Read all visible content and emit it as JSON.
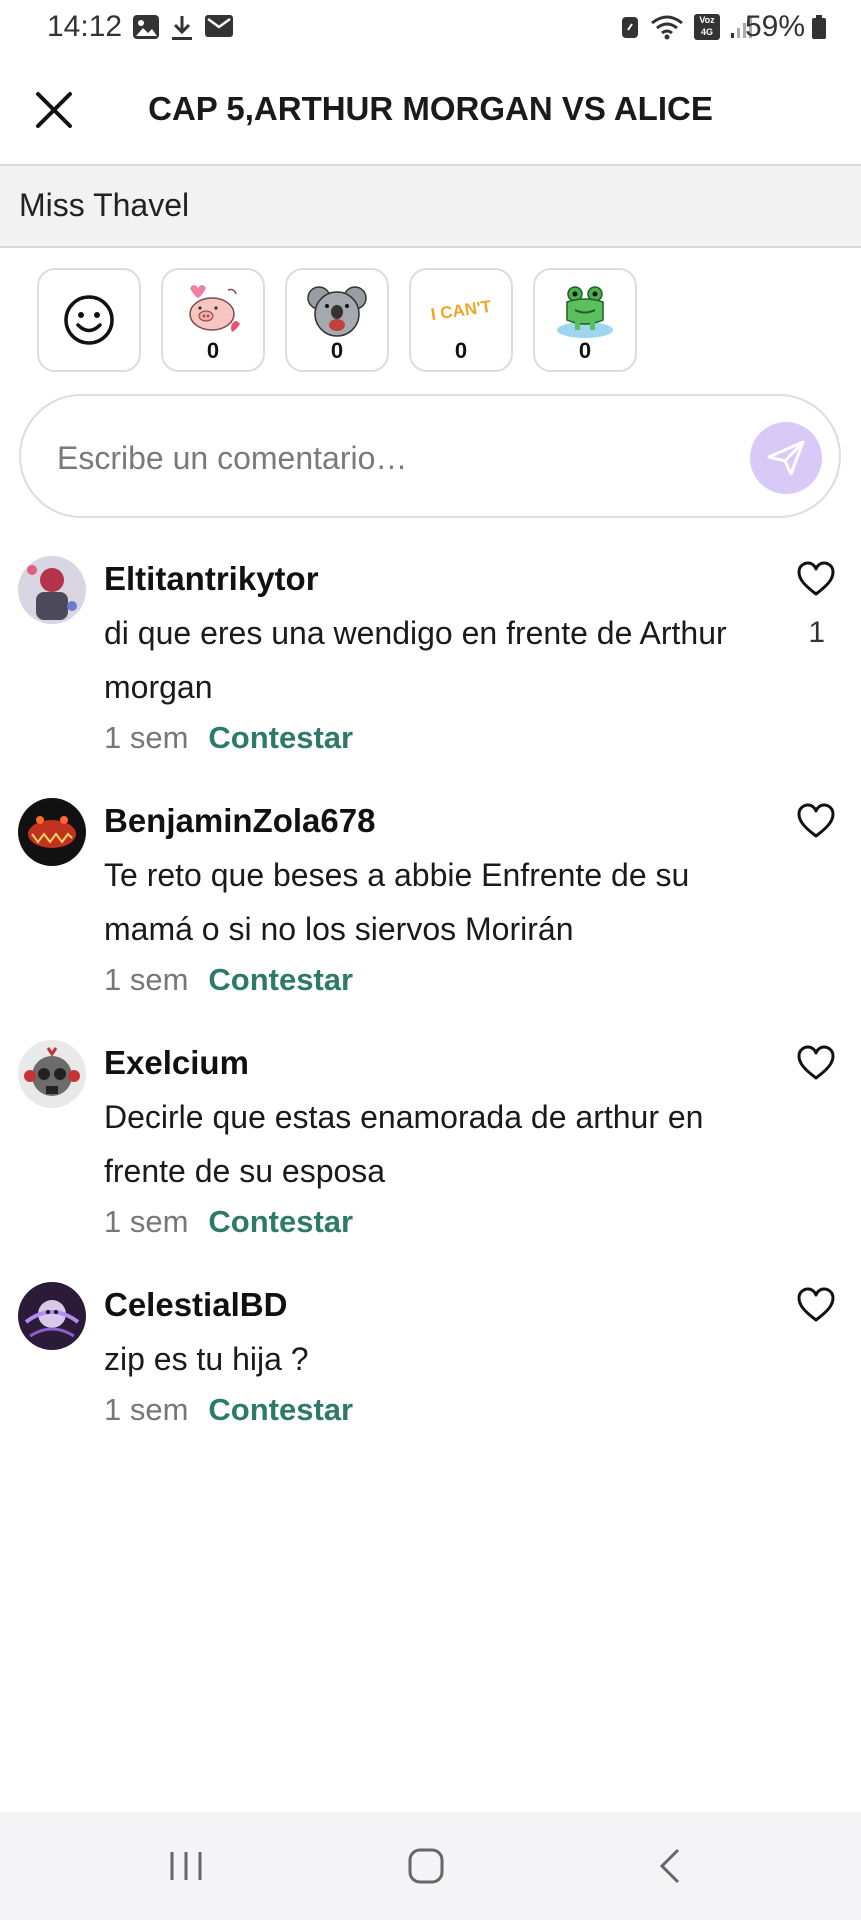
{
  "status": {
    "time": "14:12",
    "battery": "59%",
    "network_label": "Voz 4G"
  },
  "header": {
    "title": "CAP 5,ARTHUR MORGAN VS ALICE"
  },
  "author": {
    "name": "Miss Thavel"
  },
  "reactions": [
    {
      "icon": "pig-sticker-icon",
      "count": "0"
    },
    {
      "icon": "koala-sticker-icon",
      "count": "0"
    },
    {
      "icon": "i-cant-sticker-icon",
      "count": "0"
    },
    {
      "icon": "frog-sticker-icon",
      "count": "0"
    }
  ],
  "reaction_i_cant_text": "I CAN'T",
  "comment_input": {
    "placeholder": "Escribe un comentario…"
  },
  "comments": [
    {
      "user": "Eltitantrikytor",
      "text": "di que eres una wendigo en frente de Arthur morgan",
      "time": "1 sem",
      "reply": "Contestar",
      "likes": "1"
    },
    {
      "user": "BenjaminZola678",
      "text": "Te reto que beses a abbie Enfrente de su mamá o si no los siervos Morirán",
      "time": "1 sem",
      "reply": "Contestar",
      "likes": ""
    },
    {
      "user": "Exelcium",
      "text": "Decirle que estas enamorada de arthur en frente de su esposa",
      "time": "1 sem",
      "reply": "Contestar",
      "likes": ""
    },
    {
      "user": "CelestialBD",
      "text": "zip es tu hija ?",
      "time": "1 sem",
      "reply": "Contestar",
      "likes": ""
    }
  ],
  "colors": {
    "accent_reply": "#2e7a6a",
    "send_button": "#d8c9f7",
    "author_bar": "#f2f2f2"
  }
}
